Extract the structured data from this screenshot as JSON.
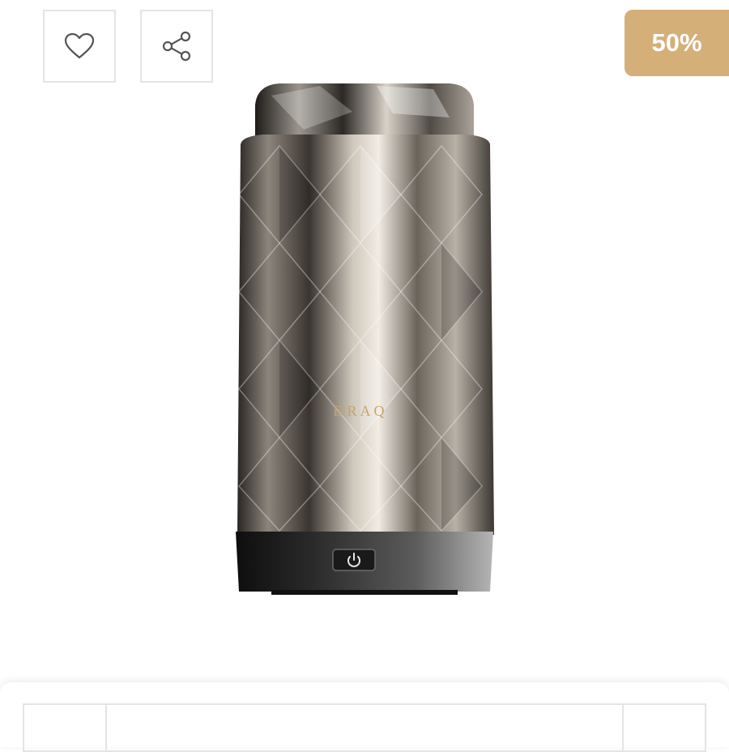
{
  "actions": {
    "favorite_icon": "heart-icon",
    "share_icon": "share-icon"
  },
  "discount_badge": {
    "label": "50%",
    "color": "#d5af78"
  },
  "product_image": {
    "brand_text": "DRAQ"
  }
}
